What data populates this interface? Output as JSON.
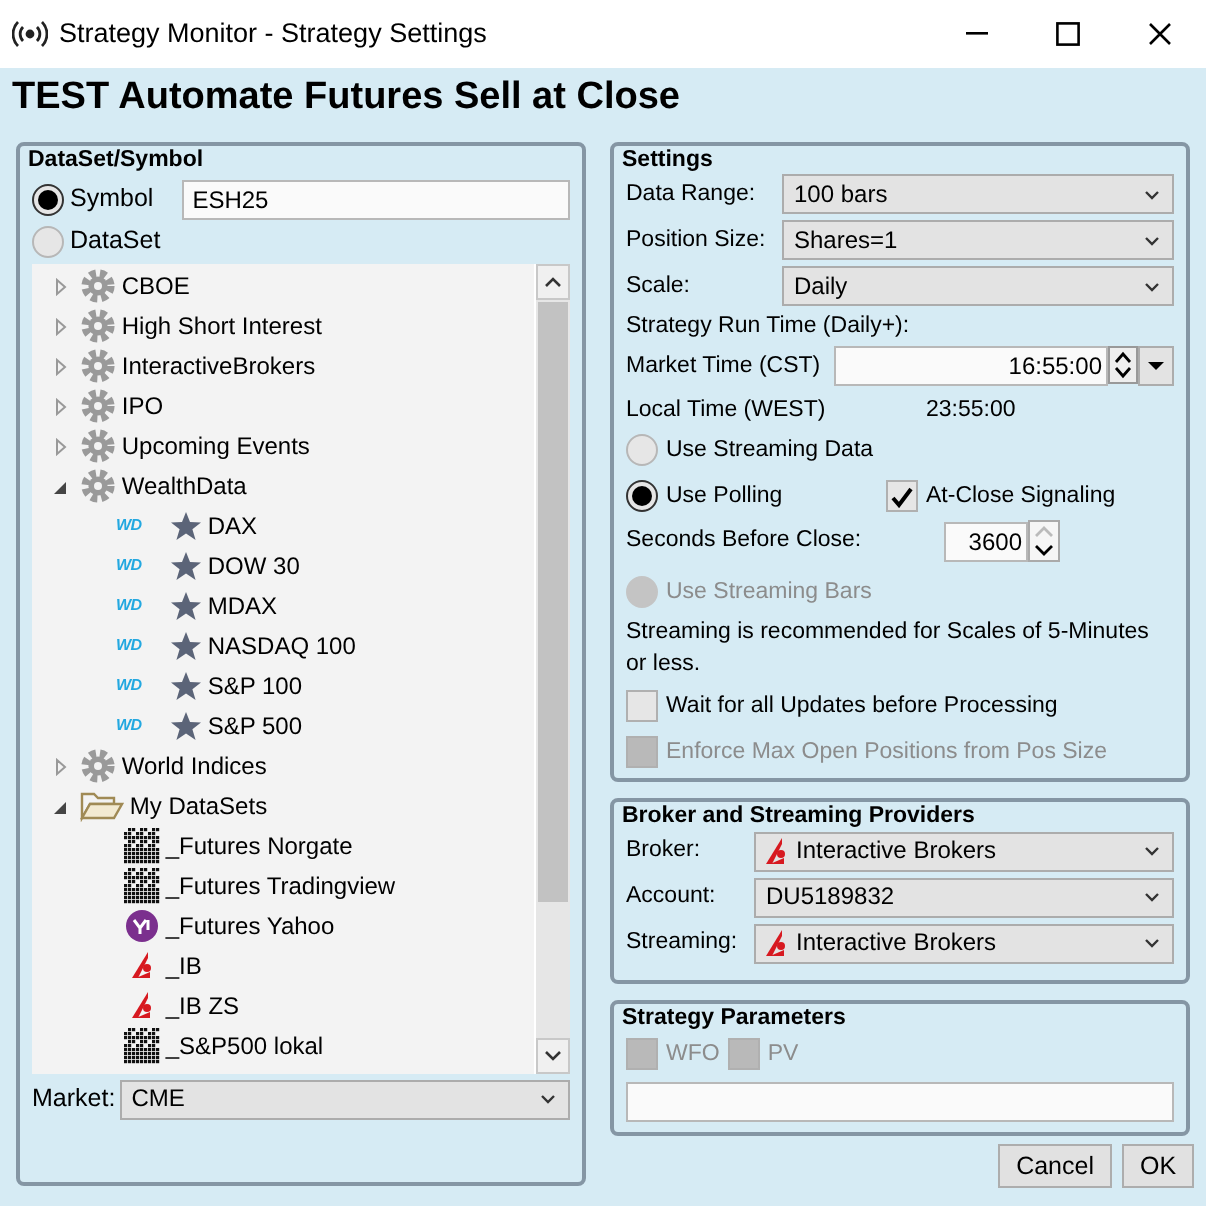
{
  "window": {
    "title": "Strategy Monitor - Strategy Settings"
  },
  "heading": "TEST Automate Futures Sell at Close",
  "dataset_symbol": {
    "title": "DataSet/Symbol",
    "source": [
      {
        "label": "Symbol",
        "selected": true
      },
      {
        "label": "DataSet",
        "selected": false
      }
    ],
    "symbol_value": "ESH25",
    "tree": [
      {
        "label": "CBOE",
        "kind": "gear",
        "expanded": false
      },
      {
        "label": "High Short Interest",
        "kind": "gear",
        "expanded": false
      },
      {
        "label": "InteractiveBrokers",
        "kind": "gear",
        "expanded": false
      },
      {
        "label": "IPO",
        "kind": "gear",
        "expanded": false
      },
      {
        "label": "Upcoming Events",
        "kind": "gear",
        "expanded": false
      },
      {
        "label": "WealthData",
        "kind": "gear",
        "expanded": true,
        "children": [
          {
            "label": "DAX",
            "kind": "wd",
            "badge": "WD"
          },
          {
            "label": "DOW 30",
            "kind": "wd",
            "badge": "WD"
          },
          {
            "label": "MDAX",
            "kind": "wd",
            "badge": "WD"
          },
          {
            "label": "NASDAQ 100",
            "kind": "wd",
            "badge": "WD"
          },
          {
            "label": "S&P 100",
            "kind": "wd",
            "badge": "WD"
          },
          {
            "label": "S&P 500",
            "kind": "wd",
            "badge": "WD"
          }
        ]
      },
      {
        "label": "World Indices",
        "kind": "gear",
        "expanded": false
      },
      {
        "label": "My DataSets",
        "kind": "folder",
        "expanded": true,
        "children": [
          {
            "label": "_Futures Norgate",
            "kind": "grid"
          },
          {
            "label": "_Futures Tradingview",
            "kind": "grid"
          },
          {
            "label": "_Futures Yahoo",
            "kind": "yahoo"
          },
          {
            "label": "_IB",
            "kind": "ib"
          },
          {
            "label": "_IB ZS",
            "kind": "ib"
          },
          {
            "label": "_S&P500 lokal",
            "kind": "grid"
          }
        ]
      }
    ],
    "market_label": "Market:",
    "market_value": "CME"
  },
  "settings": {
    "title": "Settings",
    "selects": [
      {
        "label": "Data Range:",
        "value": "100 bars"
      },
      {
        "label": "Position Size:",
        "value": "Shares=1"
      },
      {
        "label": "Scale:",
        "value": "Daily"
      }
    ],
    "run_time_label": "Strategy Run Time (Daily+):",
    "market_time": {
      "label": "Market Time (CST)",
      "value": "16:55:00"
    },
    "local_time": {
      "label": "Local Time (WEST)",
      "value": "23:55:00"
    },
    "streaming_data": {
      "label": "Use Streaming Data",
      "selected": false,
      "disabled": false
    },
    "polling": {
      "label": "Use Polling",
      "selected": true,
      "disabled": false
    },
    "at_close": {
      "label": "At-Close Signaling",
      "checked": true,
      "disabled": false
    },
    "seconds_before_close": {
      "label": "Seconds Before Close:",
      "value": "3600"
    },
    "streaming_bars": {
      "label": "Use Streaming Bars",
      "selected": false,
      "disabled": true
    },
    "note": "Streaming is recommended for Scales of 5-Minutes or less.",
    "wait_updates": {
      "label": "Wait for all Updates before Processing",
      "checked": false,
      "disabled": false
    },
    "enforce_max": {
      "label": "Enforce Max Open Positions from Pos Size",
      "checked": false,
      "disabled": true
    }
  },
  "providers": {
    "title": "Broker and Streaming Providers",
    "fields": [
      {
        "label": "Broker:",
        "value": "Interactive Brokers",
        "kind": "broker"
      },
      {
        "label": "Account:",
        "value": "DU5189832",
        "kind": "plain"
      },
      {
        "label": "Streaming:",
        "value": "Interactive Brokers",
        "kind": "broker"
      }
    ]
  },
  "parameters": {
    "title": "Strategy Parameters",
    "checks": [
      {
        "label": "WFO",
        "checked": false,
        "disabled": true
      },
      {
        "label": "PV",
        "checked": false,
        "disabled": true
      }
    ]
  },
  "buttons": [
    "Cancel",
    "OK"
  ]
}
